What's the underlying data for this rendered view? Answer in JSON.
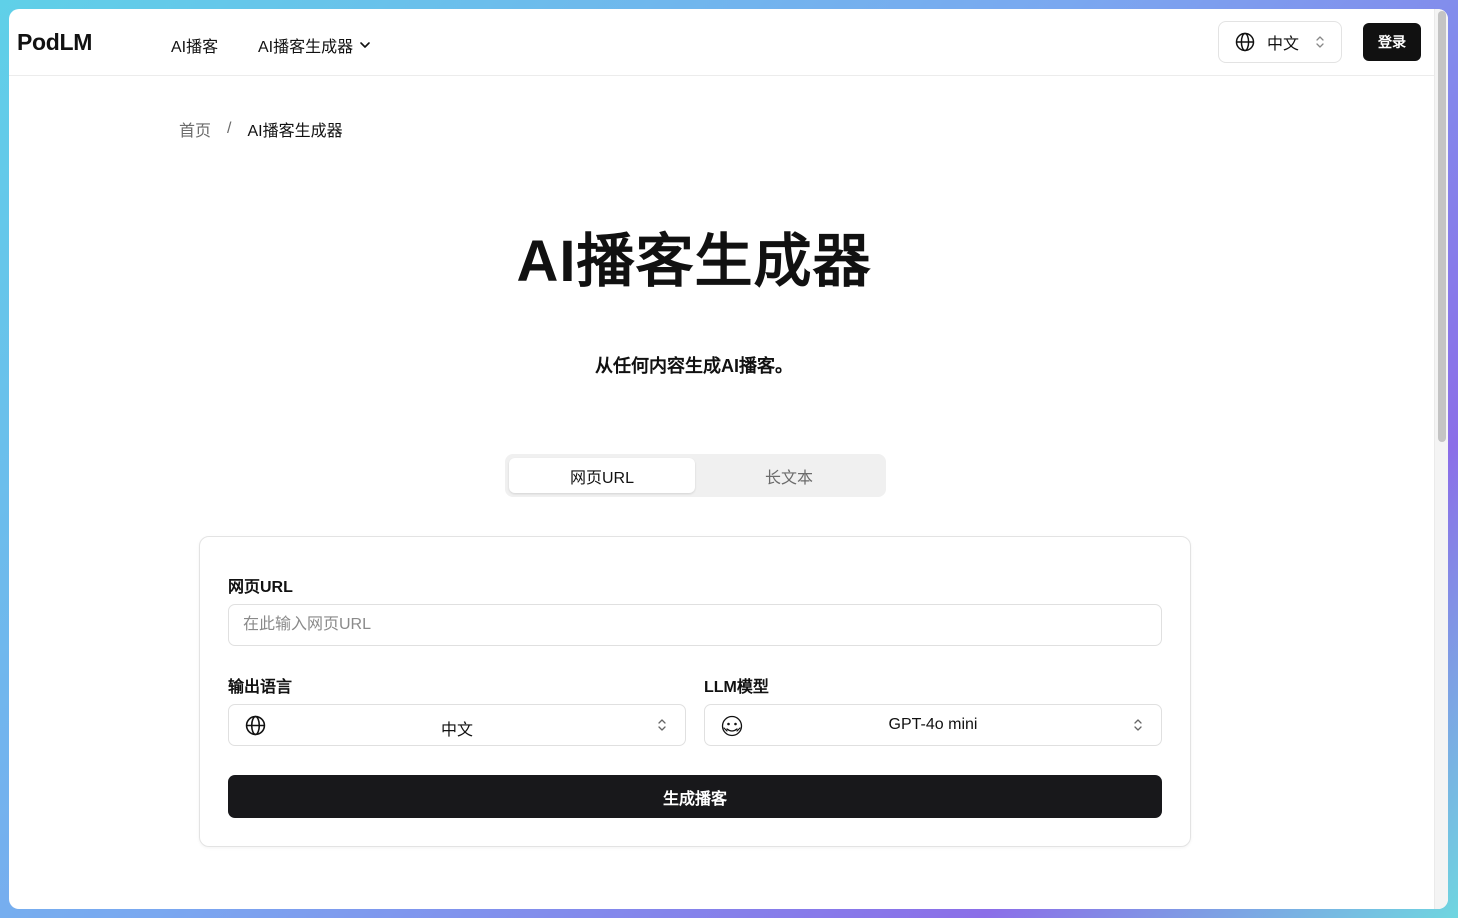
{
  "header": {
    "logo": "PodLM",
    "nav": [
      {
        "label": "AI播客"
      },
      {
        "label": "AI播客生成器"
      }
    ],
    "language": "中文",
    "login_label": "登录"
  },
  "breadcrumb": {
    "home": "首页",
    "separator": "/",
    "current": "AI播客生成器"
  },
  "hero": {
    "title": "AI播客生成器",
    "subtitle": "从任何内容生成AI播客。"
  },
  "tabs": [
    {
      "label": "网页URL",
      "active": true
    },
    {
      "label": "长文本",
      "active": false
    }
  ],
  "form": {
    "url_label": "网页URL",
    "url_placeholder": "在此输入网页URL",
    "url_value": "",
    "language_label": "输出语言",
    "language_value": "中文",
    "model_label": "LLM模型",
    "model_value": "GPT-4o mini",
    "submit_label": "生成播客"
  },
  "icons": {
    "language": "globe-icon",
    "model": "openai-icon",
    "dropdown": "chevron-down-icon",
    "select": "chevron-up-down-icon"
  },
  "colors": {
    "primary_button": "#18181b",
    "muted_text": "#6b6b6b"
  }
}
